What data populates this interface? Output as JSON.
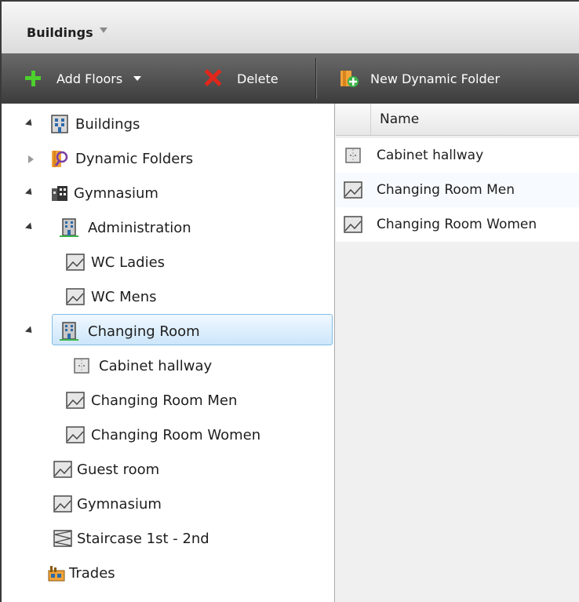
{
  "panel": {
    "title": "Buildings"
  },
  "toolbar": {
    "add_floors_label": "Add Floors",
    "delete_label": "Delete",
    "new_dynamic_folder_label": "New Dynamic Folder"
  },
  "tree": {
    "items": [
      {
        "label": "Buildings",
        "icon": "building-icon"
      },
      {
        "label": "Dynamic Folders",
        "icon": "dynamic-folder-icon"
      },
      {
        "label": "Gymnasium",
        "icon": "site-icon"
      },
      {
        "label": "Administration",
        "icon": "building-icon"
      },
      {
        "label": "WC Ladies",
        "icon": "room-icon"
      },
      {
        "label": "WC Mens",
        "icon": "room-icon"
      },
      {
        "label": "Changing Room",
        "icon": "building-icon"
      },
      {
        "label": "Cabinet hallway",
        "icon": "hallway-icon"
      },
      {
        "label": "Changing Room Men",
        "icon": "room-icon"
      },
      {
        "label": "Changing Room Women",
        "icon": "room-icon"
      },
      {
        "label": "Guest room",
        "icon": "room-icon"
      },
      {
        "label": "Gymnasium",
        "icon": "room-icon"
      },
      {
        "label": "Staircase 1st - 2nd",
        "icon": "staircase-icon"
      },
      {
        "label": "Trades",
        "icon": "trades-icon"
      }
    ]
  },
  "list": {
    "column_name": "Name",
    "rows": [
      {
        "name": "Cabinet hallway",
        "icon": "hallway-icon"
      },
      {
        "name": "Changing Room Men",
        "icon": "room-icon"
      },
      {
        "name": "Changing Room Women",
        "icon": "room-icon"
      }
    ]
  },
  "colors": {
    "selection_fill": "#cce6fb",
    "selection_border": "#84bde6",
    "toolbar_bg": "#4a4a4a"
  }
}
